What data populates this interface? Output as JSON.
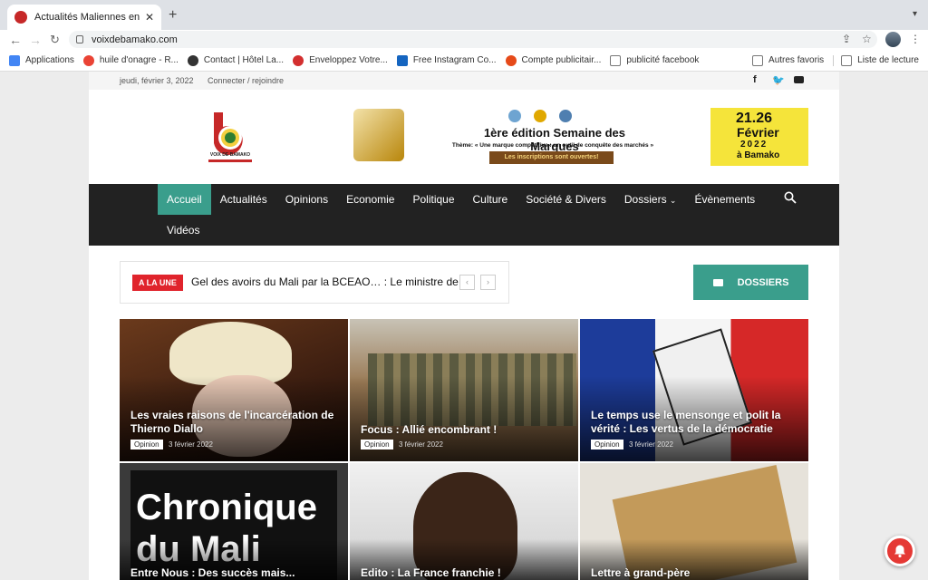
{
  "browser": {
    "tab_title": "Actualités Maliennes en temps r",
    "url": "voixdebamako.com",
    "bookmarks": [
      {
        "label": "Applications",
        "color": "#4285f4"
      },
      {
        "label": "huile d'onagre - R...",
        "color": "#ea4335"
      },
      {
        "label": "Contact | Hôtel La...",
        "color": "#333333"
      },
      {
        "label": "Enveloppez Votre...",
        "color": "#d32f2f"
      },
      {
        "label": "Free Instagram Co...",
        "color": "#1565c0"
      },
      {
        "label": "Compte publicitair...",
        "color": "#e64a19"
      },
      {
        "label": "publicité facebook",
        "color": "#777777"
      }
    ],
    "other_favorites": "Autres favoris",
    "reading_list": "Liste de lecture"
  },
  "topbar": {
    "date": "jeudi, février 3, 2022",
    "login": "Connecter / rejoindre"
  },
  "header": {
    "logo_text": "VOIX DE BAMAKO",
    "banner_title": "1ère édition Semaine des Marques",
    "banner_theme": "Thème: « Une marque compétitive : un outil de conquête des marchés »",
    "banner_cta": "Les inscriptions sont ouvertes!",
    "event_dates": "21.26",
    "event_month": "Février",
    "event_year": "2022",
    "event_place": "à Bamako"
  },
  "nav": {
    "items": [
      "Accueil",
      "Actualités",
      "Opinions",
      "Economie",
      "Politique",
      "Culture",
      "Société & Divers",
      "Dossiers",
      "Évènements"
    ],
    "row2": "Vidéos",
    "accent": "#3a9e8c"
  },
  "ticker": {
    "badge": "A LA UNE",
    "text": "Gel des avoirs du Mali par la BCEAO… : Le ministre de"
  },
  "dossiers_button": "DOSSIERS",
  "articles": [
    {
      "title": "Les vraies raisons de l'incarcération de Thierno Diallo",
      "category": "Opinion",
      "date": "3 février 2022"
    },
    {
      "title": "Focus : Allié encombrant !",
      "category": "Opinion",
      "date": "3 février 2022"
    },
    {
      "title": "Le temps use le mensonge et polit la vérité : Les vertus de la démocratie",
      "category": "Opinion",
      "date": "3 février 2022"
    },
    {
      "title": "Entre Nous : Des succès mais...",
      "image_text": "Chronique du Mali"
    },
    {
      "title": "Edito : La France franchie !"
    },
    {
      "title": "Lettre à grand-père"
    }
  ]
}
